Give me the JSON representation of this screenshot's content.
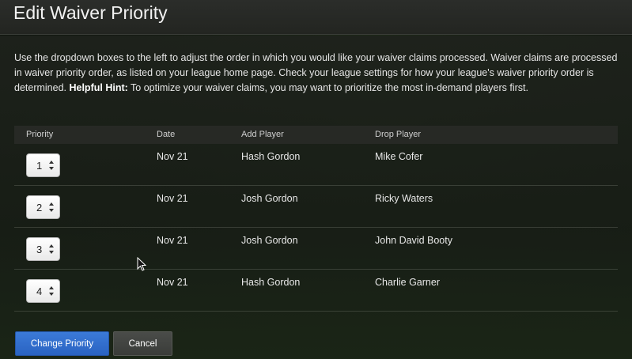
{
  "header": {
    "title": "Edit Waiver Priority"
  },
  "intro": {
    "text_main": "Use the dropdown boxes to the left to adjust the order in which you would like your waiver claims processed. Waiver claims are processed in waiver priority order, as listed on your league home page. Check your league settings for how your league's waiver priority order is determined. ",
    "hint_label": "Helpful Hint:",
    "hint_text": " To optimize your waiver claims, you may want to prioritize the most in-demand players first."
  },
  "table": {
    "columns": {
      "priority": "Priority",
      "date": "Date",
      "add_player": "Add Player",
      "drop_player": "Drop Player"
    },
    "rows": [
      {
        "priority": "1",
        "date": "Nov 21",
        "add_player": "Hash Gordon",
        "drop_player": "Mike Cofer"
      },
      {
        "priority": "2",
        "date": "Nov 21",
        "add_player": "Josh Gordon",
        "drop_player": "Ricky Waters"
      },
      {
        "priority": "3",
        "date": "Nov 21",
        "add_player": "Josh Gordon",
        "drop_player": "John David Booty"
      },
      {
        "priority": "4",
        "date": "Nov 21",
        "add_player": "Hash Gordon",
        "drop_player": "Charlie Garner"
      }
    ]
  },
  "buttons": {
    "change_priority": "Change Priority",
    "cancel": "Cancel"
  },
  "colors": {
    "primary_button": "#2a63c2",
    "secondary_button": "#3a3c39"
  },
  "icons": {
    "select_arrows": "up-down-arrows-icon",
    "cursor": "mouse-pointer-icon"
  }
}
